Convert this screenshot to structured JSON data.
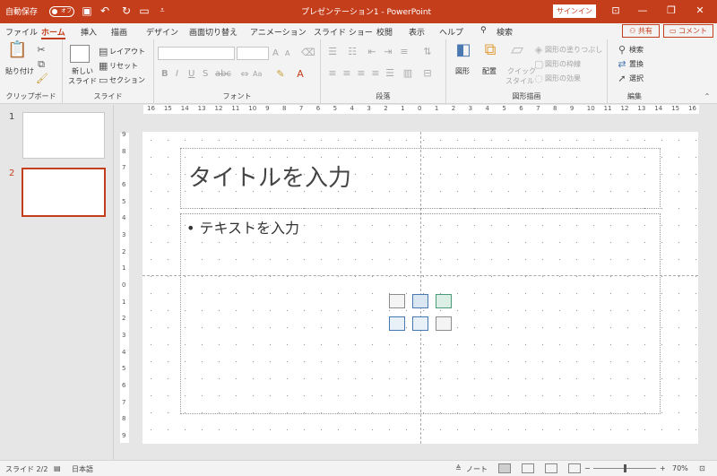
{
  "titlebar": {
    "autosave_label": "自動保存",
    "autosave_state": "オフ",
    "document_title": "プレゼンテーション1 - PowerPoint",
    "signin_label": "サインイン",
    "accent": "#c43e1c"
  },
  "tabs": [
    {
      "label": "ファイル"
    },
    {
      "label": "ホーム"
    },
    {
      "label": "挿入"
    },
    {
      "label": "描画"
    },
    {
      "label": "デザイン"
    },
    {
      "label": "画面切り替え"
    },
    {
      "label": "アニメーション"
    },
    {
      "label": "スライド ショー"
    },
    {
      "label": "校閲"
    },
    {
      "label": "表示"
    },
    {
      "label": "ヘルプ"
    },
    {
      "label": "検索"
    }
  ],
  "actions": {
    "share": "共有",
    "comment": "コメント"
  },
  "ribbon": {
    "clipboard": {
      "paste": "貼り付け",
      "group": "クリップボード"
    },
    "slides": {
      "new_slide": "新しい",
      "new_slide2": "スライド",
      "layout": "レイアウト",
      "reset": "リセット",
      "section": "セクション",
      "group": "スライド"
    },
    "font": {
      "grow": "A",
      "shrink": "A",
      "change_case": "Aa",
      "group": "フォント"
    },
    "paragraph": {
      "group": "段落"
    },
    "drawing": {
      "shapes": "図形",
      "arrange": "配置",
      "quick_styles": "クイック",
      "quick_styles2": "スタイル",
      "fill": "図形の塗りつぶし",
      "outline": "図形の枠線",
      "effects": "図形の効果",
      "group": "図形描画"
    },
    "editing": {
      "find": "検索",
      "replace": "置換",
      "select": "選択",
      "group": "編集"
    }
  },
  "thumbnails": [
    {
      "number": "1"
    },
    {
      "number": "2"
    }
  ],
  "hruler_labels": [
    "16",
    "15",
    "14",
    "13",
    "12",
    "11",
    "10",
    "9",
    "8",
    "7",
    "6",
    "5",
    "4",
    "3",
    "2",
    "1",
    "0",
    "1",
    "2",
    "3",
    "4",
    "5",
    "6",
    "7",
    "8",
    "9",
    "10",
    "11",
    "12",
    "13",
    "14",
    "15",
    "16"
  ],
  "vruler_labels": [
    "9",
    "8",
    "7",
    "6",
    "5",
    "4",
    "3",
    "2",
    "1",
    "0",
    "1",
    "2",
    "3",
    "4",
    "5",
    "6",
    "7",
    "8",
    "9"
  ],
  "slide": {
    "title_placeholder": "タイトルを入力",
    "body_placeholder": "• テキストを入力"
  },
  "status": {
    "slide_counter": "スライド 2/2",
    "language": "日本語",
    "notes": "ノート",
    "zoom": "70%",
    "zoom_fraction": 0.5
  }
}
